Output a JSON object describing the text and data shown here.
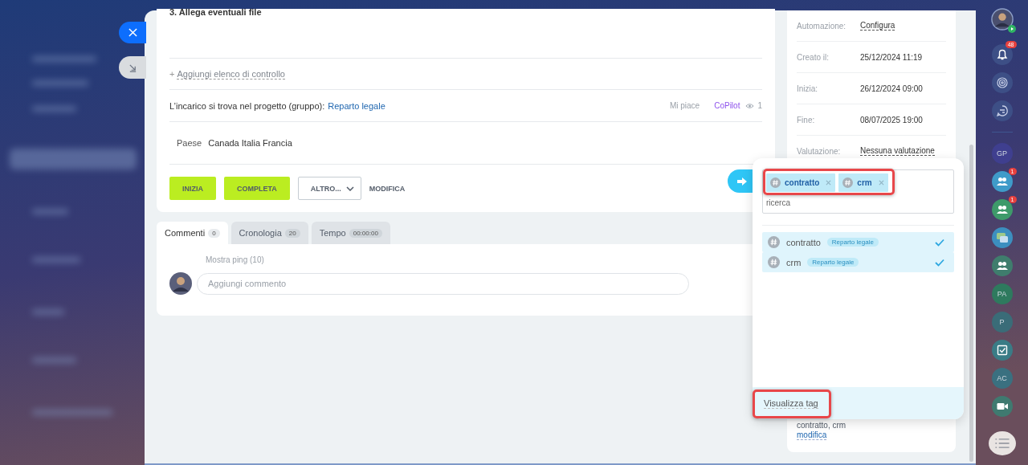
{
  "task": {
    "checklist_item": "3. Allega eventuali file",
    "add_prefix": "+",
    "add_checklist": "Aggiungi elenco di controllo",
    "project_label": "L’incarico si trova nel progetto (gruppo):",
    "project": "Reparto legale",
    "like": "Mi piace",
    "copilot": "CoPilot",
    "views": "1",
    "field_label": "Paese",
    "field_value": "Canada Italia Francia"
  },
  "actions": [
    {
      "label": "INIZIA",
      "kind": "primary"
    },
    {
      "label": "COMPLETA",
      "kind": "primary"
    },
    {
      "label": "ALTRO...",
      "kind": "dropdown"
    },
    {
      "label": "MODIFICA",
      "kind": "link"
    }
  ],
  "tabs": [
    {
      "label": "Commenti",
      "count": "0",
      "selected": true
    },
    {
      "label": "Cronologia",
      "count": "20",
      "selected": false
    },
    {
      "label": "Tempo",
      "count": "00:00:00",
      "selected": false
    }
  ],
  "comments": {
    "show_pings": "Mostra ping (10)",
    "placeholder": "Aggiungi commento"
  },
  "details": [
    {
      "label": "Automazione:",
      "value": "Configura",
      "kind": "link"
    },
    {
      "label": "Creato il:",
      "value": "25/12/2024 11:19",
      "kind": "text"
    },
    {
      "label": "Inizia:",
      "value": "26/12/2024 09:00",
      "kind": "text"
    },
    {
      "label": "Fine:",
      "value": "08/07/2025 19:00",
      "kind": "text"
    },
    {
      "label": "Valutazione:",
      "value": "Nessuna valutazione",
      "kind": "link"
    }
  ],
  "tags": {
    "value": "contratto, crm",
    "edit": "modifica"
  },
  "tag_popup": {
    "chips": [
      {
        "label": "contratto"
      },
      {
        "label": "crm"
      }
    ],
    "search_placeholder": "ricerca",
    "results": [
      {
        "label": "contratto",
        "group": "Reparto legale",
        "checked": true
      },
      {
        "label": "crm",
        "group": "Reparto legale",
        "checked": true
      }
    ],
    "footer": "Visualizza tag"
  },
  "right_bar": [
    {
      "kind": "bell",
      "badge": "48"
    },
    {
      "kind": "spiral"
    },
    {
      "kind": "chat-arrows"
    },
    {
      "kind": "divider"
    },
    {
      "kind": "initials",
      "text": "GP",
      "color": "#3f3f8f"
    },
    {
      "kind": "group",
      "badge": "1",
      "color": "#3f9bc9"
    },
    {
      "kind": "group",
      "badge": "1",
      "color": "#3e9a6a"
    },
    {
      "kind": "message",
      "color": "#3c8fbf"
    },
    {
      "kind": "group",
      "color": "#3f7d6d"
    },
    {
      "kind": "initials",
      "text": "PA",
      "color": "#2e7a5e"
    },
    {
      "kind": "initials",
      "text": "P",
      "color": "#3a6c78"
    },
    {
      "kind": "checkbox",
      "color": "#3a7c86"
    },
    {
      "kind": "initials",
      "text": "AC",
      "color": "#3a7080"
    },
    {
      "kind": "video",
      "color": "#3f7a70"
    }
  ]
}
